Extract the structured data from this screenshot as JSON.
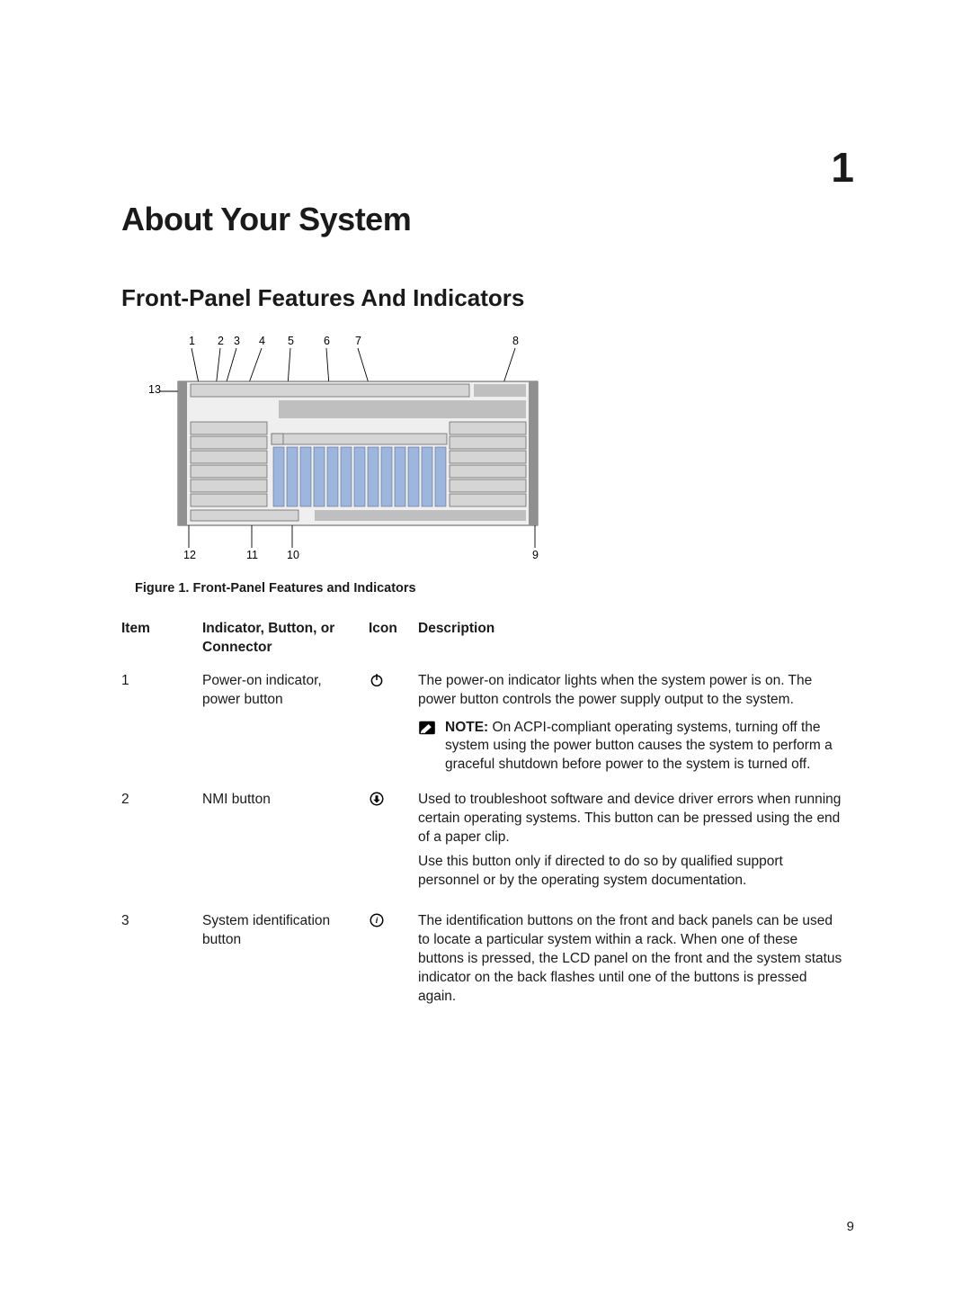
{
  "chapter_number": "1",
  "title": "About Your System",
  "section_heading": "Front-Panel Features And Indicators",
  "figure": {
    "caption": "Figure 1. Front-Panel Features and Indicators",
    "callouts_top": [
      "1",
      "2",
      "3",
      "4",
      "5",
      "6",
      "7",
      "8"
    ],
    "callouts_side": [
      "13"
    ],
    "callouts_bottom": [
      "12",
      "11",
      "10",
      "9"
    ]
  },
  "table": {
    "headers": {
      "item": "Item",
      "indicator": "Indicator, Button, or Connector",
      "icon": "Icon",
      "description": "Description"
    },
    "rows": [
      {
        "item": "1",
        "indicator": "Power-on indicator, power button",
        "icon": "power-icon",
        "description": "The power-on indicator lights when the system power is on. The power button controls the power supply output to the system.",
        "note_label": "NOTE:",
        "note_body": " On ACPI-compliant operating systems, turning off the system using the power button causes the system to perform a graceful shutdown before power to the system is turned off."
      },
      {
        "item": "2",
        "indicator": "NMI button",
        "icon": "nmi-icon",
        "description": "Used to troubleshoot software and device driver errors when running certain operating systems. This button can be pressed using the end of a paper clip.",
        "description2": "Use this button only if directed to do so by qualified support personnel or by the operating system documentation."
      },
      {
        "item": "3",
        "indicator": "System identification button",
        "icon": "id-icon",
        "description": "The identification buttons on the front and back panels can be used to locate a particular system within a rack. When one of these buttons is pressed, the LCD panel on the front and the system status indicator on the back flashes until one of the buttons is pressed again."
      }
    ]
  },
  "page_number": "9"
}
